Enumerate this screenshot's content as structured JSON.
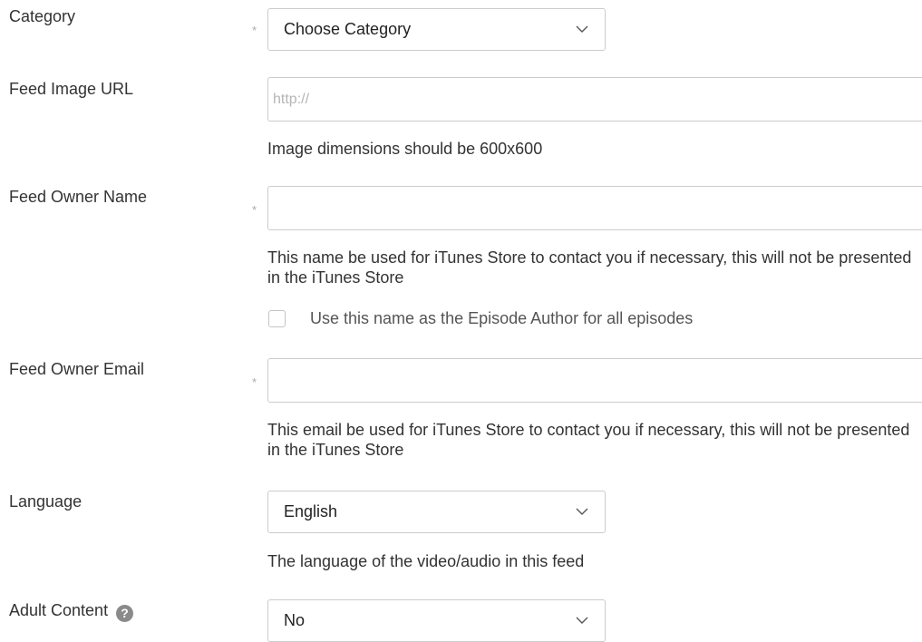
{
  "required_marker": "*",
  "category": {
    "label": "Category",
    "selected": "Choose Category"
  },
  "feed_image": {
    "label": "Feed Image URL",
    "placeholder": "http://",
    "value": "",
    "help": "Image dimensions should be 600x600"
  },
  "owner_name": {
    "label": "Feed Owner Name",
    "value": "",
    "help": "This name be used for iTunes Store to contact you if necessary, this will not be presented in the iTunes Store",
    "checkbox_label": "Use this name as the Episode Author for all episodes",
    "checkbox_checked": false
  },
  "owner_email": {
    "label": "Feed Owner Email",
    "value": "",
    "help": "This email be used for iTunes Store to contact you if necessary, this will not be presented in the iTunes Store"
  },
  "language": {
    "label": "Language",
    "selected": "English",
    "help": "The language of the video/audio in this feed"
  },
  "adult_content": {
    "label": "Adult Content",
    "help_icon_glyph": "?",
    "selected": "No"
  },
  "icons": {
    "chevron": "chevron-down-icon",
    "help": "question-circle-icon"
  },
  "colors": {
    "border": "#cccccc",
    "text": "#333333",
    "placeholder": "#b5b5b5",
    "help_icon": "#8a8a8a"
  }
}
